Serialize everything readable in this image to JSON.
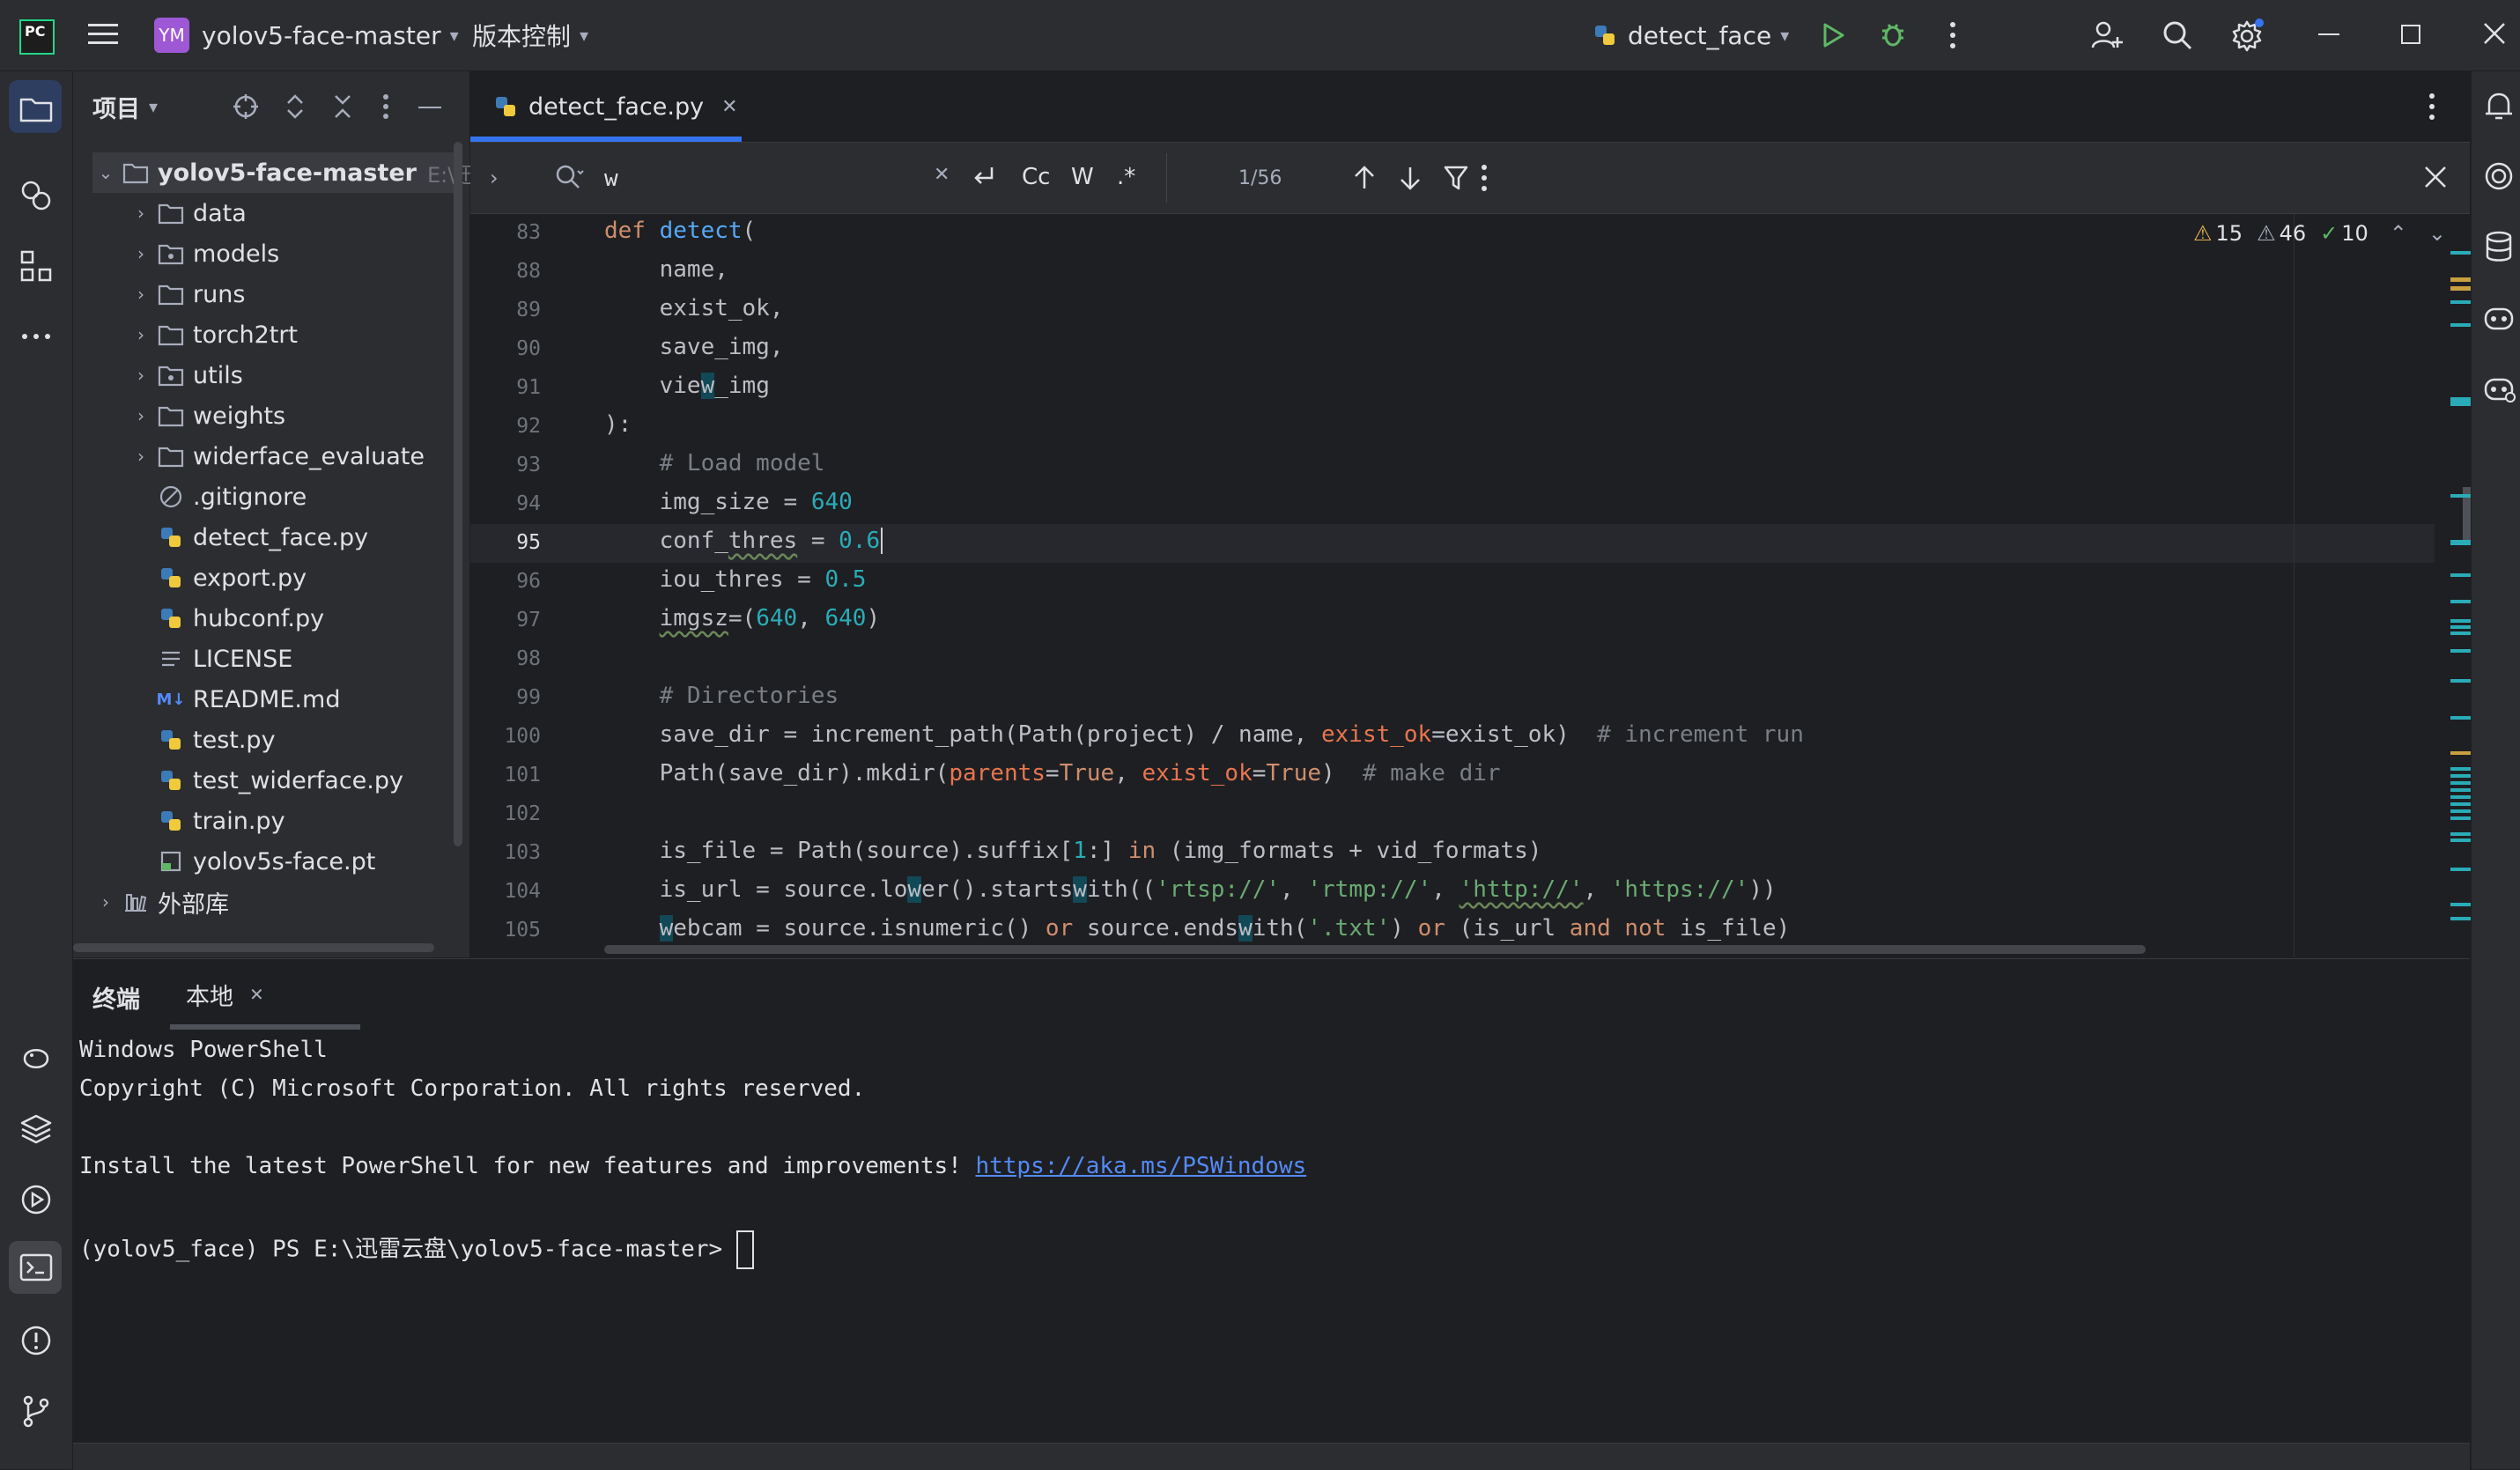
{
  "titlebar": {
    "project_badge": "YM",
    "project_name": "yolov5-face-master",
    "vcs_label": "版本控制",
    "run_config": "detect_face"
  },
  "project_panel": {
    "title": "项目",
    "root": {
      "name": "yolov5-face-master",
      "path": "E:\\迅雷"
    },
    "items": [
      {
        "name": "data"
      },
      {
        "name": "models"
      },
      {
        "name": "runs"
      },
      {
        "name": "torch2trt"
      },
      {
        "name": "utils"
      },
      {
        "name": "weights"
      },
      {
        "name": "widerface_evaluate"
      },
      {
        "name": ".gitignore"
      },
      {
        "name": "detect_face.py"
      },
      {
        "name": "export.py"
      },
      {
        "name": "hubconf.py"
      },
      {
        "name": "LICENSE"
      },
      {
        "name": "README.md"
      },
      {
        "name": "test.py"
      },
      {
        "name": "test_widerface.py"
      },
      {
        "name": "train.py"
      },
      {
        "name": "yolov5s-face.pt"
      }
    ],
    "external_libs": "外部库"
  },
  "editor": {
    "tab_label": "detect_face.py",
    "search": {
      "query": "w",
      "case_label": "Cc",
      "word_label": "W",
      "regex_label": ".*",
      "match_count": "1/56"
    },
    "inspections": {
      "warnings": "15",
      "weak_warnings": "46",
      "ok": "10"
    },
    "line_numbers": [
      "83",
      "88",
      "89",
      "90",
      "91",
      "92",
      "93",
      "94",
      "95",
      "96",
      "97",
      "98",
      "99",
      "100",
      "101",
      "102",
      "103",
      "104",
      "105"
    ],
    "code": {
      "l0_kw": "def ",
      "l0_fn": "detect",
      "l0_rest": "(",
      "l1": "    name,",
      "l2": "    exist_ok,",
      "l3": "    save_img,",
      "l4_a": "    vie",
      "l4_b": "w",
      "l4_c": "_img",
      "l5": "):",
      "l6": "    # Load model",
      "l7_a": "    img_size = ",
      "l7_b": "640",
      "l8_a": "    conf_",
      "l8_b": "thres",
      "l8_c": " = ",
      "l8_d": "0.6",
      "l9_a": "    iou_thres = ",
      "l9_b": "0.5",
      "l10_a": "    ",
      "l10_b": "imgsz",
      "l10_c": "=(",
      "l10_d": "640",
      "l10_e": ", ",
      "l10_f": "640",
      "l10_g": ")",
      "l12": "    # Directories",
      "l13_a": "    save_dir = increment_path(Path(project) / name, ",
      "l13_b": "exist_ok",
      "l13_c": "=exist_ok)  ",
      "l13_d": "# increment run",
      "l14_a": "    Path(save_dir).mkdir(",
      "l14_b": "parents",
      "l14_c": "=",
      "l14_d": "True",
      "l14_e": ", ",
      "l14_f": "exist_ok",
      "l14_g": "=",
      "l14_h": "True",
      "l14_i": ")  ",
      "l14_j": "# make dir",
      "l16_a": "    is_file = Path(source).suffix[",
      "l16_b": "1",
      "l16_c": ":] ",
      "l16_d": "in",
      "l16_e": " (img_formats + vid_formats)",
      "l17_a": "    is_url = source.lo",
      "l17_b": "w",
      "l17_c": "er().starts",
      "l17_d": "w",
      "l17_e": "ith((",
      "l17_f": "'rtsp://'",
      "l17_g": ", ",
      "l17_h": "'rtmp://'",
      "l17_i": ", ",
      "l17_j": "'http://'",
      "l17_k": ", ",
      "l17_l": "'https://'",
      "l17_m": "))",
      "l18_a": "    ",
      "l18_b": "w",
      "l18_c": "ebcam = source.isnumeric() ",
      "l18_d": "or",
      "l18_e": " source.ends",
      "l18_f": "w",
      "l18_g": "ith(",
      "l18_h": "'.txt'",
      "l18_i": ") ",
      "l18_j": "or",
      "l18_k": " (is_url ",
      "l18_l": "and not",
      "l18_m": " is_file)"
    }
  },
  "terminal": {
    "tab_title": "终端",
    "tab_local": "本地",
    "lines": [
      "Windows PowerShell",
      "Copyright (C) Microsoft Corporation. All rights reserved.",
      "",
      "Install the latest PowerShell for new features and improvements! ",
      "",
      "(yolov5_face) PS E:\\迅雷云盘\\yolov5-face-master> "
    ],
    "link": "https://aka.ms/PSWindows"
  },
  "colors": {
    "accent": "#3574f0",
    "run_green": "#5fb865",
    "warning": "#e0b050",
    "match_marker": "#2aacb8"
  }
}
